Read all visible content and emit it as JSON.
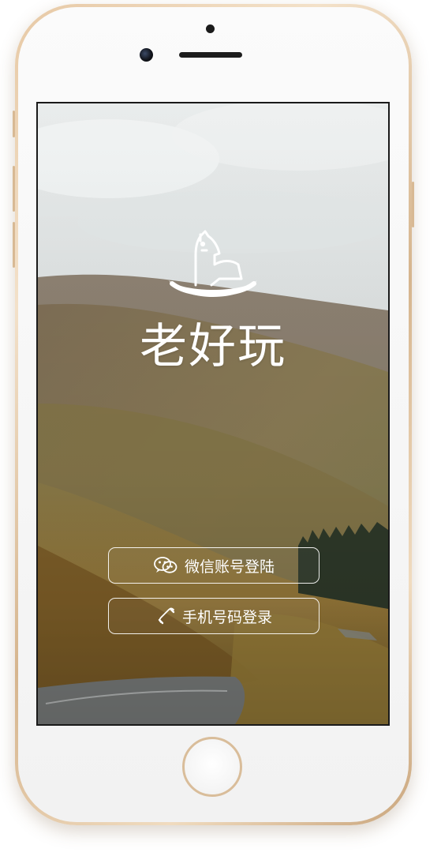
{
  "app": {
    "name": "老好玩"
  },
  "buttons": {
    "wechat_login": "微信账号登陆",
    "phone_login": "手机号码登录"
  },
  "icons": {
    "logo": "rocking-horse-icon",
    "wechat": "wechat-icon",
    "phone": "phone-icon"
  },
  "colors": {
    "text": "#ffffff",
    "button_border": "#ffffff",
    "device_frame": "#e2c39f"
  }
}
